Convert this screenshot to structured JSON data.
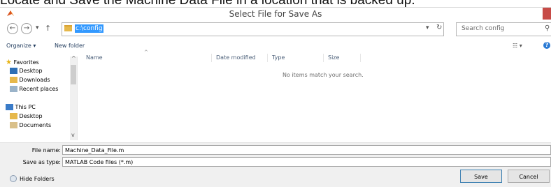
{
  "caption": "Locate and Save the Machine Data File in a location that is backed up.",
  "window": {
    "title": "Select File for Save As",
    "close_glyph": "✕"
  },
  "nav": {
    "back_glyph": "←",
    "forward_glyph": "→",
    "recent_glyph": "▾",
    "up_glyph": "↑",
    "address": "c:\\config",
    "dropdown_glyph": "▾",
    "refresh_glyph": "↻",
    "search_placeholder": "Search config",
    "search_glyph": "⚲"
  },
  "toolbar": {
    "organize_label": "Organize ▾",
    "new_folder_label": "New folder",
    "view_glyph": "☷ ▾",
    "help_glyph": "?"
  },
  "sidebar": {
    "items": [
      {
        "label": "Favorites",
        "icon": "star-icon"
      },
      {
        "label": "Desktop",
        "icon": "desktop-icon"
      },
      {
        "label": "Downloads",
        "icon": "downloads-icon"
      },
      {
        "label": "Recent places",
        "icon": "recent-places-icon"
      },
      {
        "label": "This PC",
        "icon": "computer-icon"
      },
      {
        "label": "Desktop",
        "icon": "folder-icon"
      },
      {
        "label": "Documents",
        "icon": "documents-icon"
      }
    ],
    "scroll_up": "^",
    "scroll_down": "v"
  },
  "columns": [
    "Name",
    "Date modified",
    "Type",
    "Size"
  ],
  "empty_message": "No items match your search.",
  "form": {
    "file_name_label": "File name:",
    "file_name_value": "Machine_Data_File.m",
    "save_type_label": "Save as type:",
    "save_type_value": "MATLAB Code files (*.m)"
  },
  "buttons": {
    "save": "Save",
    "cancel": "Cancel",
    "hide_folders": "Hide Folders"
  },
  "colors": {
    "accent": "#3399ff",
    "close": "#c74b47"
  }
}
